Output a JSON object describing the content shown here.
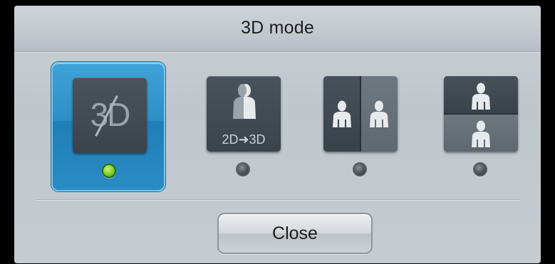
{
  "dialog": {
    "title": "3D mode"
  },
  "options": [
    {
      "icon_text": "3D",
      "icon": "3d-off-icon",
      "selected": true
    },
    {
      "icon_text": "2D➜3D",
      "icon": "2d-to-3d-icon",
      "selected": false
    },
    {
      "icon": "side-by-side-icon",
      "selected": false
    },
    {
      "icon": "top-bottom-icon",
      "selected": false
    }
  ],
  "buttons": {
    "close_label": "Close"
  },
  "colors": {
    "selected_highlight": "#2c8fc6",
    "indicator_on": "#7fcf2a",
    "indicator_off": "#4e5358",
    "panel_background": "#c4cbd1"
  }
}
